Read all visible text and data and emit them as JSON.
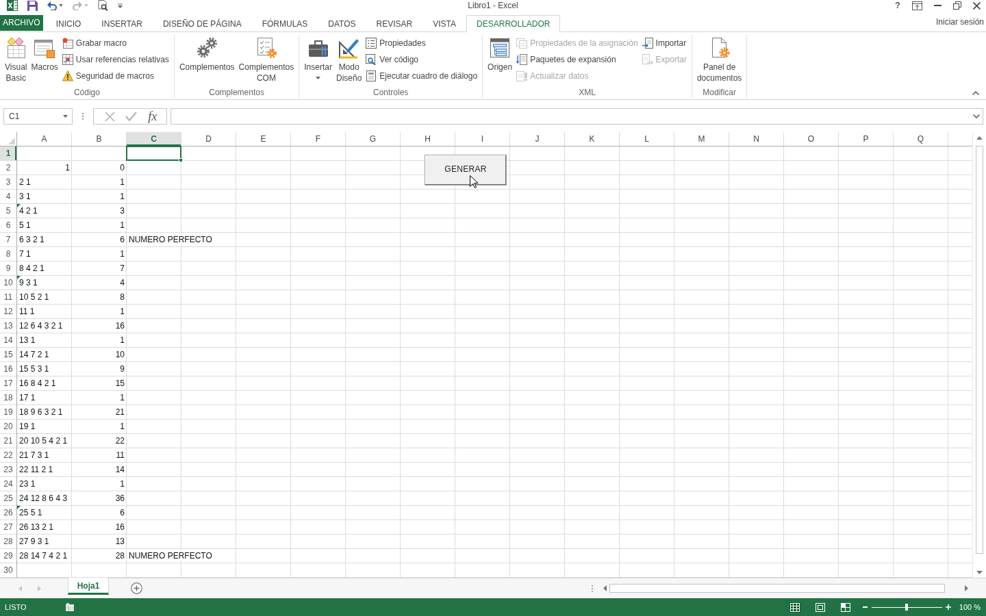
{
  "title_bar": {
    "title": "Libro1 - Excel",
    "help": "?"
  },
  "ribbon_tabs": [
    {
      "label": "ARCHIVO",
      "kind": "backstage",
      "selected": false
    },
    {
      "label": "INICIO",
      "kind": "tab",
      "selected": false
    },
    {
      "label": "INSERTAR",
      "kind": "tab",
      "selected": false
    },
    {
      "label": "DISEÑO DE PÁGINA",
      "kind": "tab",
      "selected": false
    },
    {
      "label": "FÓRMULAS",
      "kind": "tab",
      "selected": false
    },
    {
      "label": "DATOS",
      "kind": "tab",
      "selected": false
    },
    {
      "label": "REVISAR",
      "kind": "tab",
      "selected": false
    },
    {
      "label": "VISTA",
      "kind": "tab",
      "selected": false
    },
    {
      "label": "DESARROLLADOR",
      "kind": "tab",
      "selected": true
    }
  ],
  "account": "Iniciar sesión",
  "ribbon_groups": [
    {
      "label": "Código",
      "items": [
        {
          "kind": "large",
          "label": "Visual\nBasic"
        },
        {
          "kind": "large",
          "label": "Macros"
        },
        {
          "kind": "stack",
          "items": [
            {
              "label": "Grabar macro",
              "disabled": false
            },
            {
              "label": "Usar referencias relativas",
              "disabled": false
            },
            {
              "label": "Seguridad de macros",
              "disabled": false
            }
          ]
        }
      ]
    },
    {
      "label": "Complementos",
      "items": [
        {
          "kind": "large",
          "label": "Complementos"
        },
        {
          "kind": "large",
          "label": "Complementos\nCOM"
        }
      ]
    },
    {
      "label": "Controles",
      "items": [
        {
          "kind": "large",
          "label": "Insertar",
          "dropdown": true
        },
        {
          "kind": "large",
          "label": "Modo\nDiseño"
        },
        {
          "kind": "stack",
          "items": [
            {
              "label": "Propiedades",
              "disabled": false
            },
            {
              "label": "Ver código",
              "disabled": false
            },
            {
              "label": "Ejecutar cuadro de diálogo",
              "disabled": false
            }
          ]
        }
      ]
    },
    {
      "label": "XML",
      "items": [
        {
          "kind": "large",
          "label": "Origen"
        },
        {
          "kind": "stack",
          "items": [
            {
              "label": "Propiedades de la asignación",
              "disabled": true
            },
            {
              "label": "Paquetes de expansión",
              "disabled": false
            },
            {
              "label": "Actualizar datos",
              "disabled": true
            }
          ]
        },
        {
          "kind": "stack",
          "items": [
            {
              "label": "Importar",
              "disabled": false
            },
            {
              "label": "Exportar",
              "disabled": true
            }
          ]
        }
      ]
    },
    {
      "label": "Modificar",
      "items": [
        {
          "kind": "large",
          "label": "Panel de\ndocumentos"
        }
      ]
    }
  ],
  "formula_bar": {
    "name_box": "C1",
    "function_label": "fx"
  },
  "sheet": {
    "columns": [
      {
        "label": "A",
        "selected": false
      },
      {
        "label": "B",
        "selected": false
      },
      {
        "label": "C",
        "selected": true
      },
      {
        "label": "D",
        "selected": false
      },
      {
        "label": "E",
        "selected": false
      },
      {
        "label": "F",
        "selected": false
      },
      {
        "label": "G",
        "selected": false
      },
      {
        "label": "H",
        "selected": false
      },
      {
        "label": "I",
        "selected": false
      },
      {
        "label": "J",
        "selected": false
      },
      {
        "label": "K",
        "selected": false
      },
      {
        "label": "L",
        "selected": false
      },
      {
        "label": "M",
        "selected": false
      },
      {
        "label": "N",
        "selected": false
      },
      {
        "label": "O",
        "selected": false
      },
      {
        "label": "P",
        "selected": false
      },
      {
        "label": "Q",
        "selected": false
      }
    ],
    "rows": [
      {
        "header": "1",
        "selected": true
      },
      {
        "header": "2",
        "selected": false,
        "cells": [
          {
            "value": "1",
            "kind": "number",
            "flagged": false
          },
          {
            "value": "0",
            "kind": "number",
            "flagged": false
          }
        ]
      },
      {
        "header": "3",
        "selected": false,
        "cells": [
          {
            "value": "2 1",
            "kind": "text",
            "flagged": false
          },
          {
            "value": "1",
            "kind": "number",
            "flagged": false
          }
        ]
      },
      {
        "header": "4",
        "selected": false,
        "cells": [
          {
            "value": "3 1",
            "kind": "text",
            "flagged": false
          },
          {
            "value": "1",
            "kind": "number",
            "flagged": false
          }
        ]
      },
      {
        "header": "5",
        "selected": false,
        "cells": [
          {
            "value": "4 2 1",
            "kind": "text",
            "flagged": true
          },
          {
            "value": "3",
            "kind": "number",
            "flagged": false
          }
        ]
      },
      {
        "header": "6",
        "selected": false,
        "cells": [
          {
            "value": "5 1",
            "kind": "text",
            "flagged": false
          },
          {
            "value": "1",
            "kind": "number",
            "flagged": false
          }
        ]
      },
      {
        "header": "7",
        "selected": false,
        "cells": [
          {
            "value": "6 3 2 1",
            "kind": "text",
            "flagged": false
          },
          {
            "value": "6",
            "kind": "number",
            "flagged": false
          },
          {
            "value": "NUMERO PERFECTO",
            "kind": "text",
            "flagged": false
          }
        ]
      },
      {
        "header": "8",
        "selected": false,
        "cells": [
          {
            "value": "7 1",
            "kind": "text",
            "flagged": false
          },
          {
            "value": "1",
            "kind": "number",
            "flagged": false
          }
        ]
      },
      {
        "header": "9",
        "selected": false,
        "cells": [
          {
            "value": "8 4 2 1",
            "kind": "text",
            "flagged": false
          },
          {
            "value": "7",
            "kind": "number",
            "flagged": false
          }
        ]
      },
      {
        "header": "10",
        "selected": false,
        "cells": [
          {
            "value": "9 3 1",
            "kind": "text",
            "flagged": true
          },
          {
            "value": "4",
            "kind": "number",
            "flagged": false
          }
        ]
      },
      {
        "header": "11",
        "selected": false,
        "cells": [
          {
            "value": "10 5 2 1",
            "kind": "text",
            "flagged": false
          },
          {
            "value": "8",
            "kind": "number",
            "flagged": false
          }
        ]
      },
      {
        "header": "12",
        "selected": false,
        "cells": [
          {
            "value": "11 1",
            "kind": "text",
            "flagged": false
          },
          {
            "value": "1",
            "kind": "number",
            "flagged": false
          }
        ]
      },
      {
        "header": "13",
        "selected": false,
        "cells": [
          {
            "value": "12 6 4 3 2 1",
            "kind": "text",
            "flagged": false
          },
          {
            "value": "16",
            "kind": "number",
            "flagged": false
          }
        ]
      },
      {
        "header": "14",
        "selected": false,
        "cells": [
          {
            "value": "13 1",
            "kind": "text",
            "flagged": false
          },
          {
            "value": "1",
            "kind": "number",
            "flagged": false
          }
        ]
      },
      {
        "header": "15",
        "selected": false,
        "cells": [
          {
            "value": "14 7 2 1",
            "kind": "text",
            "flagged": false
          },
          {
            "value": "10",
            "kind": "number",
            "flagged": false
          }
        ]
      },
      {
        "header": "16",
        "selected": false,
        "cells": [
          {
            "value": "15 5 3 1",
            "kind": "text",
            "flagged": false
          },
          {
            "value": "9",
            "kind": "number",
            "flagged": false
          }
        ]
      },
      {
        "header": "17",
        "selected": false,
        "cells": [
          {
            "value": "16 8 4 2 1",
            "kind": "text",
            "flagged": false
          },
          {
            "value": "15",
            "kind": "number",
            "flagged": false
          }
        ]
      },
      {
        "header": "18",
        "selected": false,
        "cells": [
          {
            "value": "17 1",
            "kind": "text",
            "flagged": false
          },
          {
            "value": "1",
            "kind": "number",
            "flagged": false
          }
        ]
      },
      {
        "header": "19",
        "selected": false,
        "cells": [
          {
            "value": "18 9 6 3 2 1",
            "kind": "text",
            "flagged": false
          },
          {
            "value": "21",
            "kind": "number",
            "flagged": false
          }
        ]
      },
      {
        "header": "20",
        "selected": false,
        "cells": [
          {
            "value": "19 1",
            "kind": "text",
            "flagged": false
          },
          {
            "value": "1",
            "kind": "number",
            "flagged": false
          }
        ]
      },
      {
        "header": "21",
        "selected": false,
        "cells": [
          {
            "value": "20 10 5 4 2 1",
            "kind": "text",
            "flagged": false
          },
          {
            "value": "22",
            "kind": "number",
            "flagged": false
          }
        ]
      },
      {
        "header": "22",
        "selected": false,
        "cells": [
          {
            "value": "21 7 3 1",
            "kind": "text",
            "flagged": false
          },
          {
            "value": "11",
            "kind": "number",
            "flagged": false
          }
        ]
      },
      {
        "header": "23",
        "selected": false,
        "cells": [
          {
            "value": "22 11 2 1",
            "kind": "text",
            "flagged": false
          },
          {
            "value": "14",
            "kind": "number",
            "flagged": false
          }
        ]
      },
      {
        "header": "24",
        "selected": false,
        "cells": [
          {
            "value": "23 1",
            "kind": "text",
            "flagged": false
          },
          {
            "value": "1",
            "kind": "number",
            "flagged": false
          }
        ]
      },
      {
        "header": "25",
        "selected": false,
        "cells": [
          {
            "value": "24 12 8 6 4 3",
            "kind": "text",
            "flagged": false
          },
          {
            "value": "36",
            "kind": "number",
            "flagged": false
          }
        ]
      },
      {
        "header": "26",
        "selected": false,
        "cells": [
          {
            "value": "25 5 1",
            "kind": "text",
            "flagged": true
          },
          {
            "value": "6",
            "kind": "number",
            "flagged": false
          }
        ]
      },
      {
        "header": "27",
        "selected": false,
        "cells": [
          {
            "value": "26 13 2 1",
            "kind": "text",
            "flagged": false
          },
          {
            "value": "16",
            "kind": "number",
            "flagged": false
          }
        ]
      },
      {
        "header": "28",
        "selected": false,
        "cells": [
          {
            "value": "27 9 3 1",
            "kind": "text",
            "flagged": false
          },
          {
            "value": "13",
            "kind": "number",
            "flagged": false
          }
        ]
      },
      {
        "header": "29",
        "selected": false,
        "cells": [
          {
            "value": "28 14 7 4 2 1",
            "kind": "text",
            "flagged": false
          },
          {
            "value": "28",
            "kind": "number",
            "flagged": false
          },
          {
            "value": "NUMERO PERFECTO",
            "kind": "text",
            "flagged": false
          }
        ]
      },
      {
        "header": "30",
        "selected": false
      }
    ]
  },
  "form_button": {
    "label": "GENERAR"
  },
  "sheet_tabs": [
    {
      "label": "Hoja1",
      "selected": true
    }
  ],
  "status_bar": {
    "status": "LISTO",
    "views": [
      {
        "kind": "normal",
        "selected": true
      },
      {
        "kind": "page_layout",
        "selected": false
      },
      {
        "kind": "page_break",
        "selected": false
      }
    ],
    "zoom": {
      "level": 0.5,
      "reading": "100 %"
    }
  }
}
